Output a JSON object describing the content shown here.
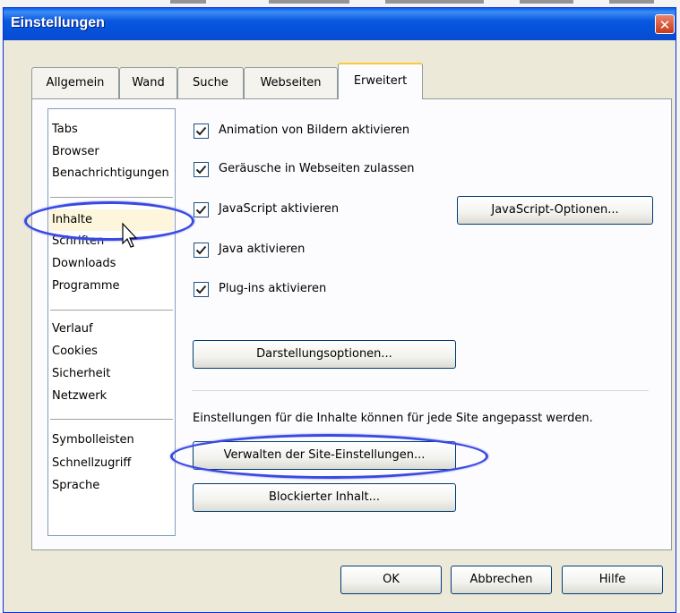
{
  "window": {
    "title": "Einstellungen",
    "close_glyph": "✕"
  },
  "tabs": [
    {
      "label": "Allgemein",
      "active": false
    },
    {
      "label": "Wand",
      "active": false
    },
    {
      "label": "Suche",
      "active": false
    },
    {
      "label": "Webseiten",
      "active": false
    },
    {
      "label": "Erweitert",
      "active": true
    }
  ],
  "sidebar": {
    "groups": [
      [
        "Tabs",
        "Browser",
        "Benachrichtigungen"
      ],
      [
        "Inhalte",
        "Schriften",
        "Downloads",
        "Programme"
      ],
      [
        "Verlauf",
        "Cookies",
        "Sicherheit",
        "Netzwerk"
      ],
      [
        "Symbolleisten",
        "Schnellzugriff",
        "Sprache"
      ]
    ],
    "selected": "Inhalte"
  },
  "content": {
    "checkboxes": [
      {
        "label": "Animation von Bildern aktivieren",
        "checked": true
      },
      {
        "label": "Geräusche in Webseiten zulassen",
        "checked": true
      },
      {
        "label": "JavaScript aktivieren",
        "checked": true
      },
      {
        "label": "Java aktivieren",
        "checked": true
      },
      {
        "label": "Plug-ins aktivieren",
        "checked": true
      }
    ],
    "javascript_options_button": "JavaScript-Optionen...",
    "display_options_button": "Darstellungsoptionen...",
    "site_info": "Einstellungen für die Inhalte können für jede Site angepasst werden.",
    "manage_site_settings_button": "Verwalten der Site-Einstellungen...",
    "blocked_content_button": "Blockierter Inhalt..."
  },
  "footer": {
    "ok_label": "OK",
    "cancel_label": "Abbrechen",
    "help_label": "Hilfe"
  },
  "colors": {
    "titlebar": "#0a5fe8",
    "highlight_ellipse": "#3a49e0",
    "active_tab_accent": "#ffc73c"
  }
}
